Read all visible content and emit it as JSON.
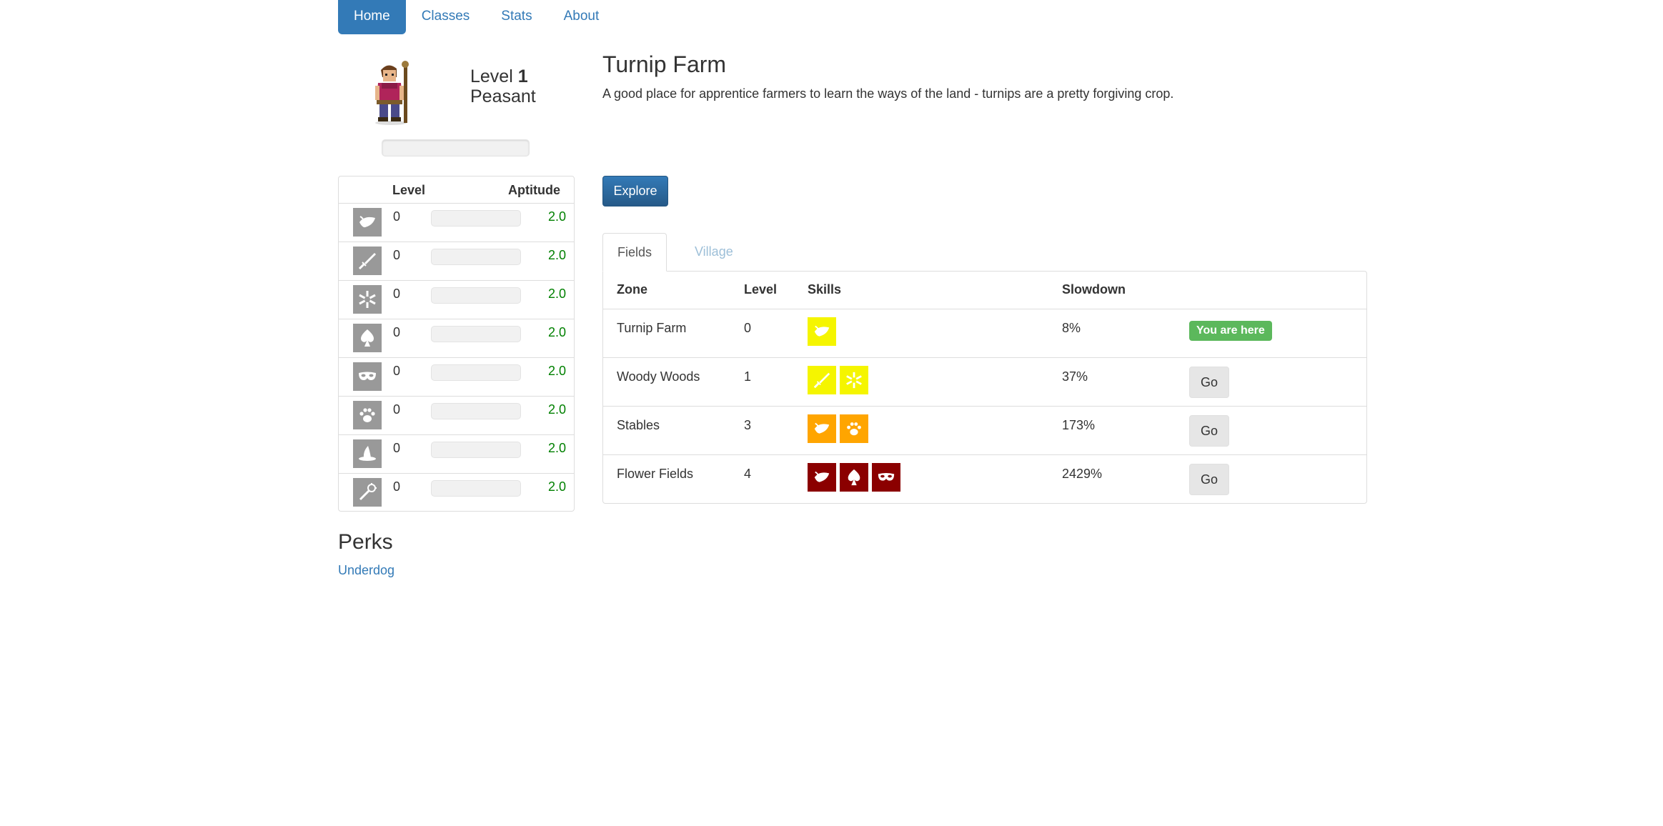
{
  "nav": {
    "items": [
      {
        "label": "Home",
        "active": true
      },
      {
        "label": "Classes",
        "active": false
      },
      {
        "label": "Stats",
        "active": false
      },
      {
        "label": "About",
        "active": false
      }
    ]
  },
  "character": {
    "level_label": "Level",
    "level_value": "1",
    "class_name": "Peasant",
    "xp_progress": 0
  },
  "skills_panel": {
    "col_level": "Level",
    "col_aptitude": "Aptitude",
    "rows": [
      {
        "icon": "leaf-icon",
        "level": "0",
        "aptitude": "2.0",
        "progress": 0
      },
      {
        "icon": "sword-icon",
        "level": "0",
        "aptitude": "2.0",
        "progress": 0
      },
      {
        "icon": "star-burst-icon",
        "level": "0",
        "aptitude": "2.0",
        "progress": 0
      },
      {
        "icon": "spade-icon",
        "level": "0",
        "aptitude": "2.0",
        "progress": 0
      },
      {
        "icon": "mask-icon",
        "level": "0",
        "aptitude": "2.0",
        "progress": 0
      },
      {
        "icon": "paw-icon",
        "level": "0",
        "aptitude": "2.0",
        "progress": 0
      },
      {
        "icon": "wizard-hat-icon",
        "level": "0",
        "aptitude": "2.0",
        "progress": 0
      },
      {
        "icon": "wand-icon",
        "level": "0",
        "aptitude": "2.0",
        "progress": 0
      }
    ]
  },
  "perks": {
    "title": "Perks",
    "items": [
      "Underdog"
    ]
  },
  "zone": {
    "title": "Turnip Farm",
    "description": "A good place for apprentice farmers to learn the ways of the land - turnips are a pretty forgiving crop.",
    "explore_label": "Explore"
  },
  "tabs": [
    "Fields",
    "Village"
  ],
  "zones_table": {
    "headers": {
      "zone": "Zone",
      "level": "Level",
      "skills": "Skills",
      "slowdown": "Slowdown"
    },
    "rows": [
      {
        "zone": "Turnip Farm",
        "level": "0",
        "skills": [
          {
            "icon": "leaf-icon",
            "color": "#f5f500"
          }
        ],
        "slowdown": "8%",
        "action": "You are here",
        "current": true
      },
      {
        "zone": "Woody Woods",
        "level": "1",
        "skills": [
          {
            "icon": "sword-icon",
            "color": "#f5f500"
          },
          {
            "icon": "star-burst-icon",
            "color": "#f5f500"
          }
        ],
        "slowdown": "37%",
        "action": "Go",
        "current": false
      },
      {
        "zone": "Stables",
        "level": "3",
        "skills": [
          {
            "icon": "leaf-icon",
            "color": "#ffa500"
          },
          {
            "icon": "paw-icon",
            "color": "#ffa500"
          }
        ],
        "slowdown": "173%",
        "action": "Go",
        "current": false
      },
      {
        "zone": "Flower Fields",
        "level": "4",
        "skills": [
          {
            "icon": "leaf-icon",
            "color": "#8b0000"
          },
          {
            "icon": "spade-icon",
            "color": "#8b0000"
          },
          {
            "icon": "mask-icon",
            "color": "#8b0000"
          }
        ],
        "slowdown": "2429%",
        "action": "Go",
        "current": false
      }
    ]
  },
  "colors": {
    "accent": "#337ab7",
    "success": "#5cb85c",
    "aptitude": "#008000",
    "skill_icon_bg": "#999999"
  }
}
